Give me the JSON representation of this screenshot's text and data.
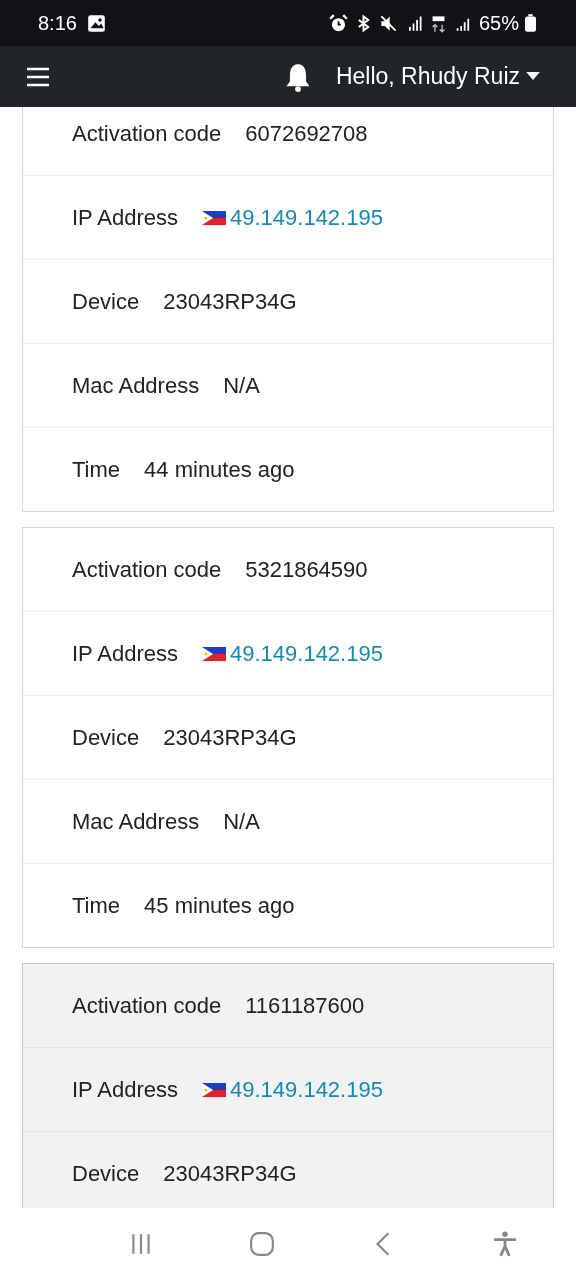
{
  "status_bar": {
    "time": "8:16",
    "battery": "65%"
  },
  "navbar": {
    "greeting": "Hello, Rhudy Ruiz"
  },
  "cards": [
    {
      "highlighted": false,
      "rows": [
        {
          "kind": "text",
          "label": "Activation code",
          "value": "6072692708"
        },
        {
          "kind": "ip",
          "label": "IP Address",
          "value": "49.149.142.195"
        },
        {
          "kind": "text",
          "label": "Device",
          "value": "23043RP34G"
        },
        {
          "kind": "text",
          "label": "Mac Address",
          "value": "N/A"
        },
        {
          "kind": "text",
          "label": "Time",
          "value": "44 minutes ago"
        }
      ]
    },
    {
      "highlighted": false,
      "rows": [
        {
          "kind": "text",
          "label": "Activation code",
          "value": "5321864590"
        },
        {
          "kind": "ip",
          "label": "IP Address",
          "value": "49.149.142.195"
        },
        {
          "kind": "text",
          "label": "Device",
          "value": "23043RP34G"
        },
        {
          "kind": "text",
          "label": "Mac Address",
          "value": "N/A"
        },
        {
          "kind": "text",
          "label": "Time",
          "value": "45 minutes ago"
        }
      ]
    },
    {
      "highlighted": true,
      "rows": [
        {
          "kind": "text",
          "label": "Activation code",
          "value": "1161187600"
        },
        {
          "kind": "ip",
          "label": "IP Address",
          "value": "49.149.142.195"
        },
        {
          "kind": "text",
          "label": "Device",
          "value": "23043RP34G"
        }
      ]
    }
  ]
}
